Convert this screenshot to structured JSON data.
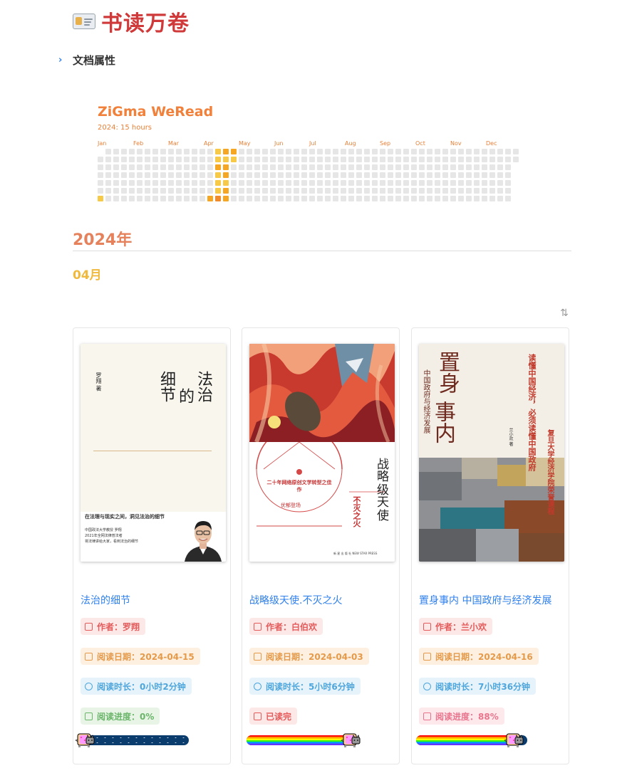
{
  "header": {
    "title": "书读万卷",
    "icon": "id-card-icon"
  },
  "doc_attr": {
    "label": "文档属性",
    "icon": "chevron-right-icon"
  },
  "heatmap": {
    "title": "ZiGma WeRead",
    "subtitle": "2024: 15 hours",
    "months": [
      "Jan",
      "Feb",
      "Mar",
      "Apr",
      "May",
      "Jun",
      "Jul",
      "Aug",
      "Sep",
      "Oct",
      "Nov",
      "Dec"
    ],
    "weeks": 54,
    "first_weekday_offset": 1,
    "colors": {
      "empty": "#e6e6e6",
      "light": "#f7c948",
      "medium": "#f5a623",
      "dark": "#ef8b2c"
    }
  },
  "year_heading": "2024年",
  "month_heading": "04月",
  "sort_icon": "sort-arrows-icon",
  "books": [
    {
      "title": "法治的细节",
      "author": "作者：罗翔",
      "date": "阅读日期：2024-04-15",
      "duration": "阅读时长：0小时2分钟",
      "status": "阅读进度：0%",
      "progress": 0,
      "cover": {
        "title_vertical": [
          "法治",
          "的",
          "细节"
        ],
        "author_vertical": "罗翔 著",
        "tagline": "在法理与现实之间，洞见法治的细节",
        "blurb": [
          "中国政法大学教授 罗翔",
          "2021年全网法律普法者",
          "将法律讲给大家，看到法治的细节"
        ]
      }
    },
    {
      "title": "战略级天使.不灭之火",
      "author": "作者：白伯欢",
      "date": "阅读日期：2024-04-03",
      "duration": "阅读时长：5小时6分钟",
      "status": "已读完",
      "progress": 1,
      "cover": {
        "title_vertical": [
          "战略",
          "级天",
          "使"
        ],
        "subtitle_vertical": "不灭之火",
        "banner": "二十年网络原创文学转型之佳作",
        "small_red": "优郁登场",
        "publisher": "新 星 出 版 社  NEW STAR PRESS"
      }
    },
    {
      "title": "置身事内 中国政府与经济发展",
      "author": "作者：兰小欢",
      "date": "阅读日期：2024-04-16",
      "duration": "阅读时长：7小时36分钟",
      "status": "阅读进度：88%",
      "progress": 0.88,
      "cover": {
        "title_vertical": [
          "置身",
          "事内"
        ],
        "subtitle_vertical": "中国政府与经济发展",
        "slogan_vertical": "读懂中国经济，必须读懂中国政府",
        "side_vertical": "复旦大学经济学院荣誉课程",
        "author_vertical": "兰小欢 著"
      }
    }
  ]
}
